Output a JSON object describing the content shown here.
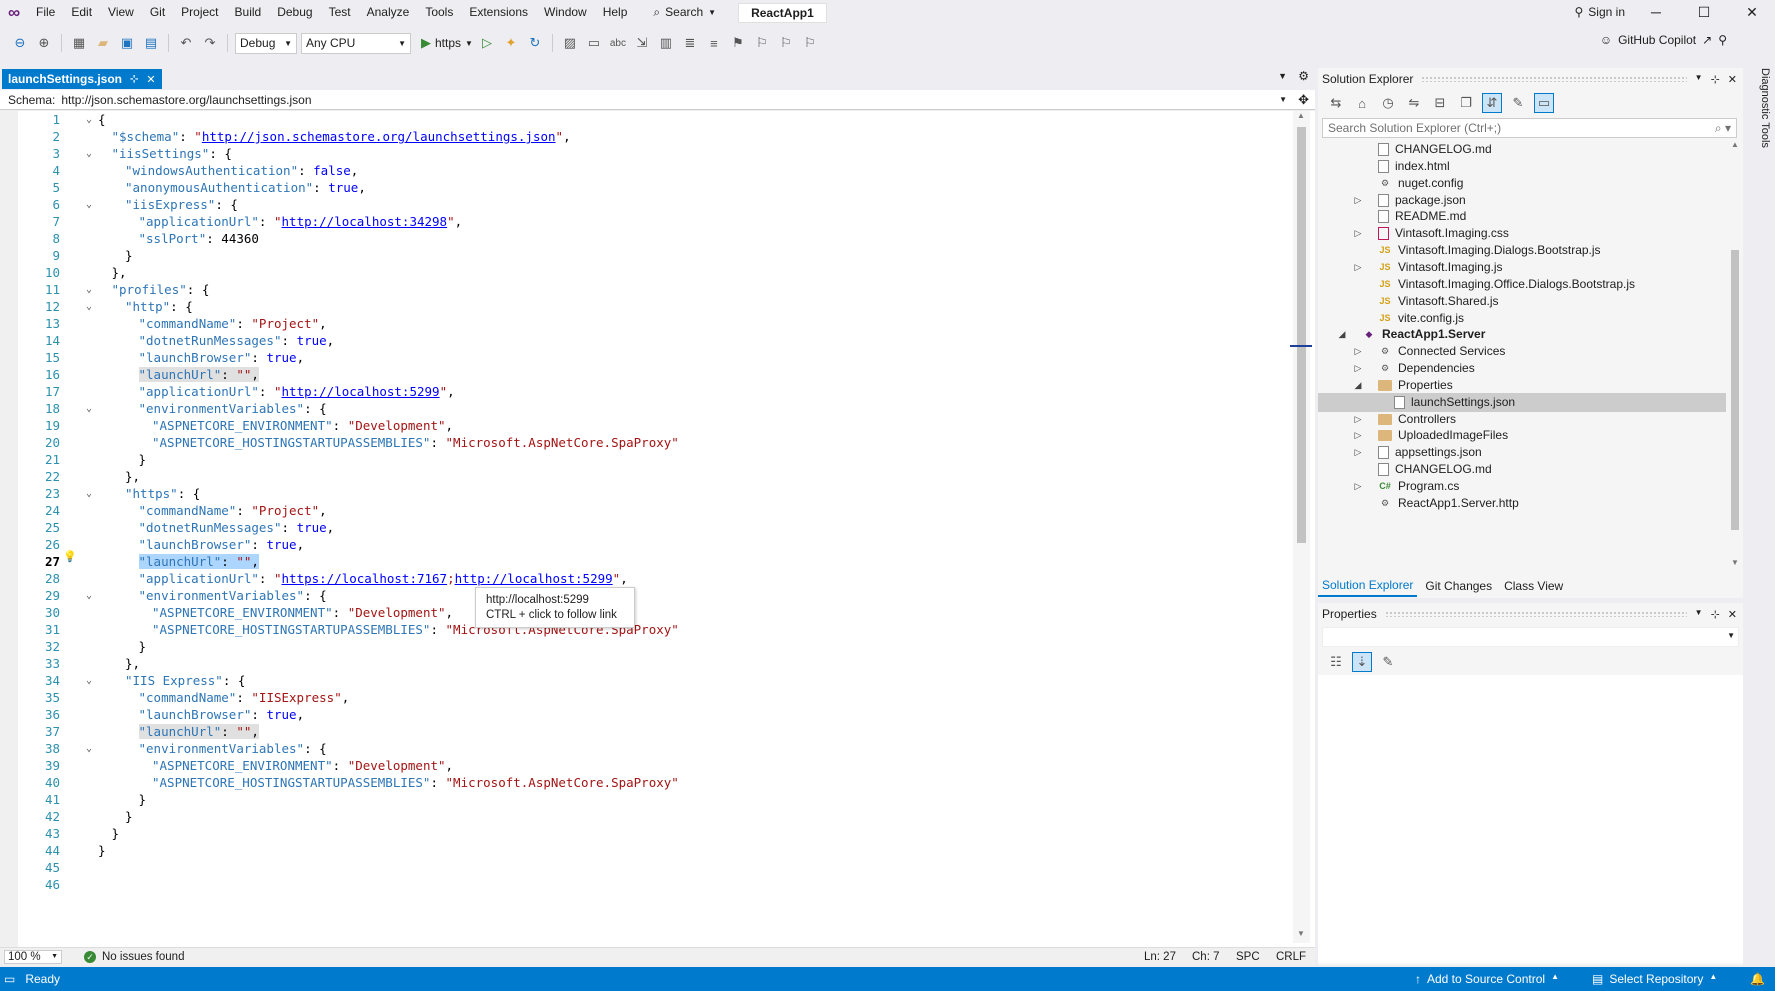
{
  "menu": {
    "items": [
      "File",
      "Edit",
      "View",
      "Git",
      "Project",
      "Build",
      "Debug",
      "Test",
      "Analyze",
      "Tools",
      "Extensions",
      "Window",
      "Help"
    ],
    "search_label": "Search",
    "app_title": "ReactApp1",
    "sign_in": "Sign in"
  },
  "toolbar": {
    "config": "Debug",
    "platform": "Any CPU",
    "run_label": "https",
    "copilot": "GitHub Copilot"
  },
  "editor": {
    "tab_title": "launchSettings.json",
    "schema_label": "Schema:",
    "schema_url": "http://json.schemastore.org/launchsettings.json",
    "tooltip_line1": "http://localhost:5299",
    "tooltip_line2": "CTRL + click to follow link",
    "zoom": "100 %",
    "issues": "No issues found",
    "ln": "Ln: 27",
    "ch": "Ch: 7",
    "spc": "SPC",
    "crlf": "CRLF",
    "current_line": 27,
    "lines": [
      {
        "n": 1,
        "fold": true,
        "i": 0,
        "t": [
          [
            "p",
            "{"
          ]
        ]
      },
      {
        "n": 2,
        "i": 1,
        "t": [
          [
            "k",
            "\"$schema\""
          ],
          [
            "p",
            ": "
          ],
          [
            "s",
            "\""
          ],
          [
            "u",
            "http://json.schemastore.org/launchsettings.json"
          ],
          [
            "s",
            "\""
          ],
          [
            "p",
            ","
          ]
        ]
      },
      {
        "n": 3,
        "fold": true,
        "i": 1,
        "t": [
          [
            "k",
            "\"iisSettings\""
          ],
          [
            "p",
            ": {"
          ]
        ]
      },
      {
        "n": 4,
        "i": 2,
        "t": [
          [
            "k",
            "\"windowsAuthentication\""
          ],
          [
            "p",
            ": "
          ],
          [
            "b",
            "false"
          ],
          [
            "p",
            ","
          ]
        ]
      },
      {
        "n": 5,
        "i": 2,
        "t": [
          [
            "k",
            "\"anonymousAuthentication\""
          ],
          [
            "p",
            ": "
          ],
          [
            "b",
            "true"
          ],
          [
            "p",
            ","
          ]
        ]
      },
      {
        "n": 6,
        "fold": true,
        "i": 2,
        "t": [
          [
            "k",
            "\"iisExpress\""
          ],
          [
            "p",
            ": {"
          ]
        ]
      },
      {
        "n": 7,
        "i": 3,
        "t": [
          [
            "k",
            "\"applicationUrl\""
          ],
          [
            "p",
            ": "
          ],
          [
            "s",
            "\""
          ],
          [
            "u",
            "http://localhost:34298"
          ],
          [
            "s",
            "\""
          ],
          [
            "p",
            ","
          ]
        ]
      },
      {
        "n": 8,
        "i": 3,
        "t": [
          [
            "k",
            "\"sslPort\""
          ],
          [
            "p",
            ": "
          ],
          [
            "n",
            "44360"
          ]
        ]
      },
      {
        "n": 9,
        "i": 2,
        "t": [
          [
            "p",
            "}"
          ]
        ]
      },
      {
        "n": 10,
        "i": 1,
        "t": [
          [
            "p",
            "},"
          ]
        ]
      },
      {
        "n": 11,
        "fold": true,
        "i": 1,
        "t": [
          [
            "k",
            "\"profiles\""
          ],
          [
            "p",
            ": {"
          ]
        ]
      },
      {
        "n": 12,
        "fold": true,
        "i": 2,
        "t": [
          [
            "k",
            "\"http\""
          ],
          [
            "p",
            ": {"
          ]
        ]
      },
      {
        "n": 13,
        "i": 3,
        "t": [
          [
            "k",
            "\"commandName\""
          ],
          [
            "p",
            ": "
          ],
          [
            "s",
            "\"Project\""
          ],
          [
            "p",
            ","
          ]
        ]
      },
      {
        "n": 14,
        "i": 3,
        "t": [
          [
            "k",
            "\"dotnetRunMessages\""
          ],
          [
            "p",
            ": "
          ],
          [
            "b",
            "true"
          ],
          [
            "p",
            ","
          ]
        ]
      },
      {
        "n": 15,
        "i": 3,
        "t": [
          [
            "k",
            "\"launchBrowser\""
          ],
          [
            "p",
            ": "
          ],
          [
            "b",
            "true"
          ],
          [
            "p",
            ","
          ]
        ]
      },
      {
        "n": 16,
        "i": 3,
        "t": [
          [
            "khl",
            "\"launchUrl\""
          ],
          [
            "phl",
            ": "
          ],
          [
            "shl",
            "\"\""
          ],
          [
            "phl",
            ","
          ]
        ]
      },
      {
        "n": 17,
        "i": 3,
        "t": [
          [
            "k",
            "\"applicationUrl\""
          ],
          [
            "p",
            ": "
          ],
          [
            "s",
            "\""
          ],
          [
            "u",
            "http://localhost:5299"
          ],
          [
            "s",
            "\""
          ],
          [
            "p",
            ","
          ]
        ]
      },
      {
        "n": 18,
        "fold": true,
        "i": 3,
        "t": [
          [
            "k",
            "\"environmentVariables\""
          ],
          [
            "p",
            ": {"
          ]
        ]
      },
      {
        "n": 19,
        "i": 4,
        "t": [
          [
            "k",
            "\"ASPNETCORE_ENVIRONMENT\""
          ],
          [
            "p",
            ": "
          ],
          [
            "s",
            "\"Development\""
          ],
          [
            "p",
            ","
          ]
        ]
      },
      {
        "n": 20,
        "i": 4,
        "t": [
          [
            "k",
            "\"ASPNETCORE_HOSTINGSTARTUPASSEMBLIES\""
          ],
          [
            "p",
            ": "
          ],
          [
            "s",
            "\"Microsoft.AspNetCore.SpaProxy\""
          ]
        ]
      },
      {
        "n": 21,
        "i": 3,
        "t": [
          [
            "p",
            "}"
          ]
        ]
      },
      {
        "n": 22,
        "i": 2,
        "t": [
          [
            "p",
            "},"
          ]
        ]
      },
      {
        "n": 23,
        "fold": true,
        "i": 2,
        "t": [
          [
            "k",
            "\"https\""
          ],
          [
            "p",
            ": {"
          ]
        ]
      },
      {
        "n": 24,
        "i": 3,
        "t": [
          [
            "k",
            "\"commandName\""
          ],
          [
            "p",
            ": "
          ],
          [
            "s",
            "\"Project\""
          ],
          [
            "p",
            ","
          ]
        ]
      },
      {
        "n": 25,
        "i": 3,
        "t": [
          [
            "k",
            "\"dotnetRunMessages\""
          ],
          [
            "p",
            ": "
          ],
          [
            "b",
            "true"
          ],
          [
            "p",
            ","
          ]
        ]
      },
      {
        "n": 26,
        "i": 3,
        "t": [
          [
            "k",
            "\"launchBrowser\""
          ],
          [
            "p",
            ": "
          ],
          [
            "b",
            "true"
          ],
          [
            "p",
            ","
          ]
        ]
      },
      {
        "n": 27,
        "i": 3,
        "t": [
          [
            "ksel",
            "\"launchUrl\""
          ],
          [
            "psel",
            ": "
          ],
          [
            "ssel",
            "\"\""
          ],
          [
            "psel",
            ","
          ]
        ]
      },
      {
        "n": 28,
        "i": 3,
        "t": [
          [
            "k",
            "\"applicationUrl\""
          ],
          [
            "p",
            ": "
          ],
          [
            "s",
            "\""
          ],
          [
            "u",
            "https://localhost:7167"
          ],
          [
            "s",
            ";"
          ],
          [
            "u",
            "http://localhost:5299"
          ],
          [
            "s",
            "\""
          ],
          [
            "p",
            ","
          ]
        ]
      },
      {
        "n": 29,
        "fold": true,
        "i": 3,
        "t": [
          [
            "k",
            "\"environmentVariables\""
          ],
          [
            "p",
            ": {"
          ]
        ]
      },
      {
        "n": 30,
        "i": 4,
        "t": [
          [
            "k",
            "\"ASPNETCORE_ENVIRONMENT\""
          ],
          [
            "p",
            ": "
          ],
          [
            "s",
            "\"Development\""
          ],
          [
            "p",
            ","
          ]
        ]
      },
      {
        "n": 31,
        "i": 4,
        "t": [
          [
            "k",
            "\"ASPNETCORE_HOSTINGSTARTUPASSEMBLIES\""
          ],
          [
            "p",
            ": "
          ],
          [
            "s",
            "\"Microsoft.AspNetCore.SpaProxy\""
          ]
        ]
      },
      {
        "n": 32,
        "i": 3,
        "t": [
          [
            "p",
            "}"
          ]
        ]
      },
      {
        "n": 33,
        "i": 2,
        "t": [
          [
            "p",
            "},"
          ]
        ]
      },
      {
        "n": 34,
        "fold": true,
        "i": 2,
        "t": [
          [
            "k",
            "\"IIS Express\""
          ],
          [
            "p",
            ": {"
          ]
        ]
      },
      {
        "n": 35,
        "i": 3,
        "t": [
          [
            "k",
            "\"commandName\""
          ],
          [
            "p",
            ": "
          ],
          [
            "s",
            "\"IISExpress\""
          ],
          [
            "p",
            ","
          ]
        ]
      },
      {
        "n": 36,
        "i": 3,
        "t": [
          [
            "k",
            "\"launchBrowser\""
          ],
          [
            "p",
            ": "
          ],
          [
            "b",
            "true"
          ],
          [
            "p",
            ","
          ]
        ]
      },
      {
        "n": 37,
        "i": 3,
        "t": [
          [
            "khl",
            "\"launchUrl\""
          ],
          [
            "phl",
            ": "
          ],
          [
            "shl",
            "\"\""
          ],
          [
            "phl",
            ","
          ]
        ]
      },
      {
        "n": 38,
        "fold": true,
        "i": 3,
        "t": [
          [
            "k",
            "\"environmentVariables\""
          ],
          [
            "p",
            ": {"
          ]
        ]
      },
      {
        "n": 39,
        "i": 4,
        "t": [
          [
            "k",
            "\"ASPNETCORE_ENVIRONMENT\""
          ],
          [
            "p",
            ": "
          ],
          [
            "s",
            "\"Development\""
          ],
          [
            "p",
            ","
          ]
        ]
      },
      {
        "n": 40,
        "i": 4,
        "t": [
          [
            "k",
            "\"ASPNETCORE_HOSTINGSTARTUPASSEMBLIES\""
          ],
          [
            "p",
            ": "
          ],
          [
            "s",
            "\"Microsoft.AspNetCore.SpaProxy\""
          ]
        ]
      },
      {
        "n": 41,
        "i": 3,
        "t": [
          [
            "p",
            "}"
          ]
        ]
      },
      {
        "n": 42,
        "i": 2,
        "t": [
          [
            "p",
            "}"
          ]
        ]
      },
      {
        "n": 43,
        "i": 1,
        "t": [
          [
            "p",
            "}"
          ]
        ]
      },
      {
        "n": 44,
        "i": 0,
        "t": [
          [
            "p",
            "}"
          ]
        ]
      },
      {
        "n": 45,
        "i": 0,
        "t": []
      },
      {
        "n": 46,
        "i": 0,
        "t": []
      }
    ]
  },
  "solution_explorer": {
    "title": "Solution Explorer",
    "search_placeholder": "Search Solution Explorer (Ctrl+;)",
    "items": [
      {
        "label": "CHANGELOG.md",
        "depth": 1,
        "icon": "file"
      },
      {
        "label": "index.html",
        "depth": 1,
        "icon": "file"
      },
      {
        "label": "nuget.config",
        "depth": 1,
        "icon": "gear"
      },
      {
        "label": "package.json",
        "depth": 1,
        "icon": "file",
        "exp": "collapsed"
      },
      {
        "label": "README.md",
        "depth": 1,
        "icon": "file"
      },
      {
        "label": "Vintasoft.Imaging.css",
        "depth": 1,
        "icon": "css",
        "exp": "collapsed"
      },
      {
        "label": "Vintasoft.Imaging.Dialogs.Bootstrap.js",
        "depth": 1,
        "icon": "js"
      },
      {
        "label": "Vintasoft.Imaging.js",
        "depth": 1,
        "icon": "js",
        "exp": "collapsed"
      },
      {
        "label": "Vintasoft.Imaging.Office.Dialogs.Bootstrap.js",
        "depth": 1,
        "icon": "js"
      },
      {
        "label": "Vintasoft.Shared.js",
        "depth": 1,
        "icon": "js"
      },
      {
        "label": "vite.config.js",
        "depth": 1,
        "icon": "js"
      },
      {
        "label": "ReactApp1.Server",
        "depth": 0,
        "icon": "proj",
        "exp": "expanded",
        "bold": true
      },
      {
        "label": "Connected Services",
        "depth": 1,
        "icon": "gear",
        "exp": "collapsed"
      },
      {
        "label": "Dependencies",
        "depth": 1,
        "icon": "gear",
        "exp": "collapsed"
      },
      {
        "label": "Properties",
        "depth": 1,
        "icon": "folder",
        "exp": "expanded"
      },
      {
        "label": "launchSettings.json",
        "depth": 2,
        "icon": "file",
        "selected": true
      },
      {
        "label": "Controllers",
        "depth": 1,
        "icon": "folder",
        "exp": "collapsed"
      },
      {
        "label": "UploadedImageFiles",
        "depth": 1,
        "icon": "folder",
        "exp": "collapsed"
      },
      {
        "label": "appsettings.json",
        "depth": 1,
        "icon": "file",
        "exp": "collapsed"
      },
      {
        "label": "CHANGELOG.md",
        "depth": 1,
        "icon": "file"
      },
      {
        "label": "Program.cs",
        "depth": 1,
        "icon": "cs",
        "exp": "collapsed"
      },
      {
        "label": "ReactApp1.Server.http",
        "depth": 1,
        "icon": "gear"
      }
    ],
    "tabs": [
      "Solution Explorer",
      "Git Changes",
      "Class View"
    ]
  },
  "properties": {
    "title": "Properties"
  },
  "diagnostic_tools": "Diagnostic Tools",
  "status": {
    "ready": "Ready",
    "add_source": "Add to Source Control",
    "select_repo": "Select Repository"
  },
  "colors": {
    "accent": "#007acc",
    "brand": "#68217a"
  }
}
